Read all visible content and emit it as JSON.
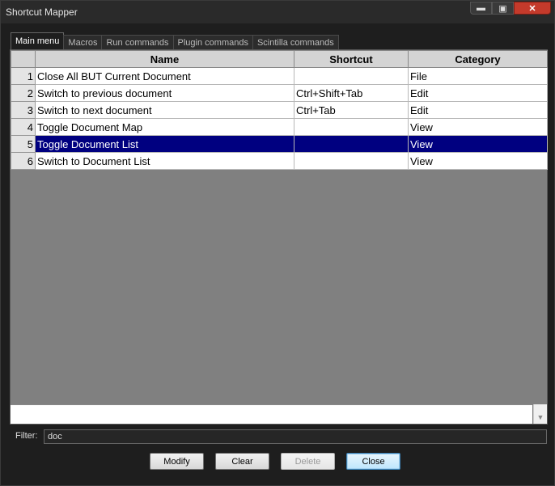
{
  "window": {
    "title": "Shortcut Mapper"
  },
  "caption": {
    "minimize": "▬",
    "maximize": "▣",
    "close": "✕"
  },
  "tabs": [
    {
      "label": "Main menu"
    },
    {
      "label": "Macros"
    },
    {
      "label": "Run commands"
    },
    {
      "label": "Plugin commands"
    },
    {
      "label": "Scintilla commands"
    }
  ],
  "grid": {
    "headers": {
      "name": "Name",
      "shortcut": "Shortcut",
      "category": "Category"
    },
    "rows": [
      {
        "num": "1",
        "name": "Close All BUT Current Document",
        "shortcut": "",
        "category": "File"
      },
      {
        "num": "2",
        "name": "Switch to previous document",
        "shortcut": "Ctrl+Shift+Tab",
        "category": "Edit"
      },
      {
        "num": "3",
        "name": "Switch to next document",
        "shortcut": "Ctrl+Tab",
        "category": "Edit"
      },
      {
        "num": "4",
        "name": "Toggle Document Map",
        "shortcut": "",
        "category": "View"
      },
      {
        "num": "5",
        "name": "Toggle Document List",
        "shortcut": "",
        "category": "View"
      },
      {
        "num": "6",
        "name": "Switch to Document List",
        "shortcut": "",
        "category": "View"
      }
    ]
  },
  "filter": {
    "label": "Filter:",
    "value": "doc"
  },
  "buttons": {
    "modify": "Modify",
    "clear": "Clear",
    "delete": "Delete",
    "close": "Close"
  },
  "colors": {
    "selection": "#000080",
    "grid_background": "#808080",
    "window_background": "#1e1e1e"
  }
}
